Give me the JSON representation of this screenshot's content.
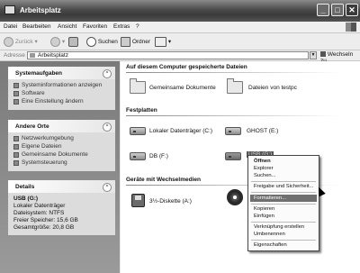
{
  "window": {
    "title": "Arbeitsplatz"
  },
  "menubar": {
    "items": [
      "Datei",
      "Bearbeiten",
      "Ansicht",
      "Favoriten",
      "Extras",
      "?"
    ]
  },
  "toolbar": {
    "back": "Zurück",
    "search": "Suchen",
    "folders": "Ordner"
  },
  "address": {
    "label": "Adresse",
    "value": "Arbeitsplatz",
    "go": "Wechseln zu"
  },
  "leftpanel": {
    "system": {
      "title": "Systemaufgaben",
      "items": [
        "Systeminformationen anzeigen",
        "Software",
        "Eine Einstellung ändern"
      ]
    },
    "places": {
      "title": "Andere Orte",
      "items": [
        "Netzwerkumgebung",
        "Eigene Dateien",
        "Gemeinsame Dokumente",
        "Systemsteuerung"
      ]
    },
    "details": {
      "title": "Details",
      "lines": [
        "USB (G:)",
        "Lokaler Datenträger",
        "Dateisystem: NTFS",
        "Freier Speicher: 15,6 GB",
        "Gesamtgröße: 20,8 GB"
      ]
    }
  },
  "main": {
    "groups": {
      "stored": "Auf diesem Computer gespeicherte Dateien",
      "drives": "Festplatten",
      "removable": "Geräte mit Wechselmedien"
    },
    "stored_items": [
      "Gemeinsame Dokumente",
      "Dateien von testpc"
    ],
    "drive_items": [
      "Lokaler Datenträger (C:)",
      "GHOST (E:)",
      "DB (F:)",
      "USB (G:)"
    ],
    "removable_items": [
      "3½-Diskette (A:)"
    ]
  },
  "context_menu": {
    "items": [
      "Öffnen",
      "Explorer",
      "Suchen...",
      "Freigabe und Sicherheit...",
      "Formatieren...",
      "Kopieren",
      "Einfügen",
      "Verknüpfung erstellen",
      "Umbenennen",
      "Eigenschaften"
    ],
    "highlighted": "Formatieren..."
  }
}
